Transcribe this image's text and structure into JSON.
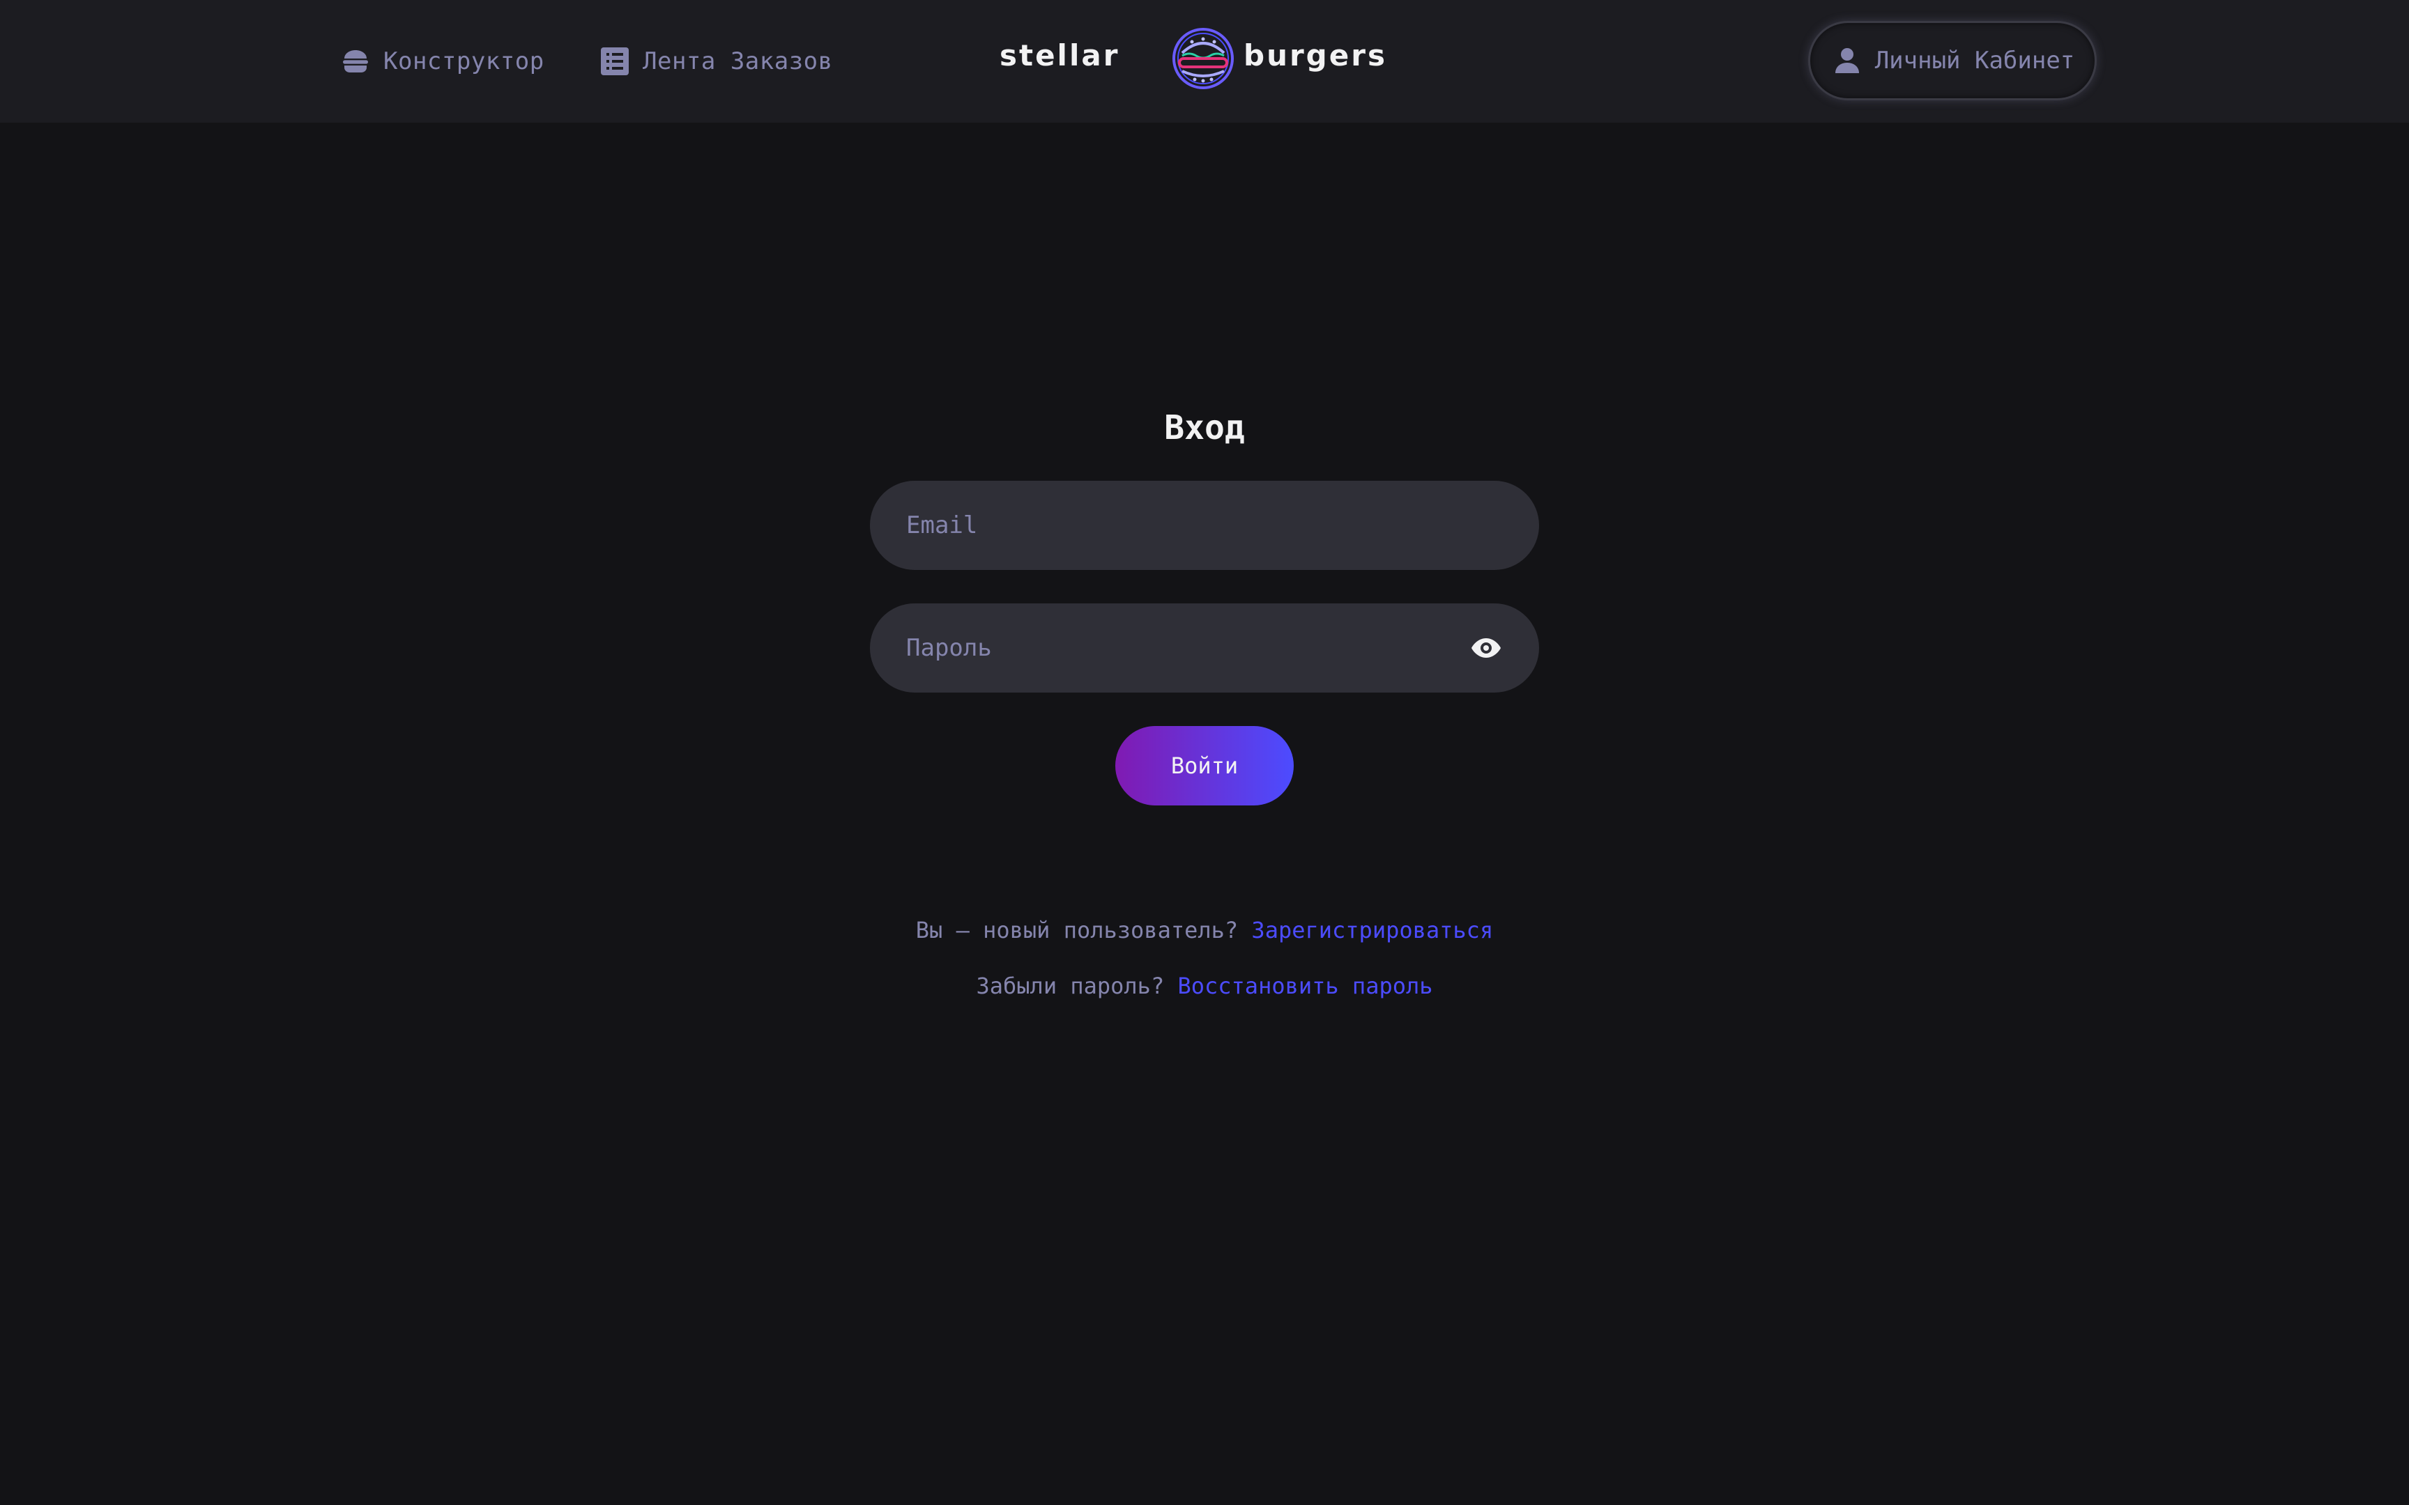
{
  "header": {
    "nav": {
      "constructor_label": "Конструктор",
      "feed_label": "Лента Заказов"
    },
    "logo": {
      "left_text": "stellar",
      "right_text": "burgers"
    },
    "profile_label": "Личный Кабинет"
  },
  "login": {
    "title": "Вход",
    "email_placeholder": "Email",
    "password_placeholder": "Пароль",
    "submit_label": "Войти",
    "register_prompt": "Вы — новый пользователь?",
    "register_link": "Зарегистрироваться",
    "forgot_prompt": "Забыли пароль?",
    "forgot_link": "Восстановить пароль"
  },
  "icons": {
    "constructor": "burger-icon",
    "feed": "list-icon",
    "profile": "user-icon",
    "password_toggle": "eye-icon"
  },
  "colors": {
    "background": "#131316",
    "header": "#1c1c21",
    "input": "#2f2f37",
    "muted_text": "#8585ad",
    "accent": "#4c4cff",
    "button_gradient_start": "#801ab2",
    "button_gradient_end": "#4c4cff"
  }
}
